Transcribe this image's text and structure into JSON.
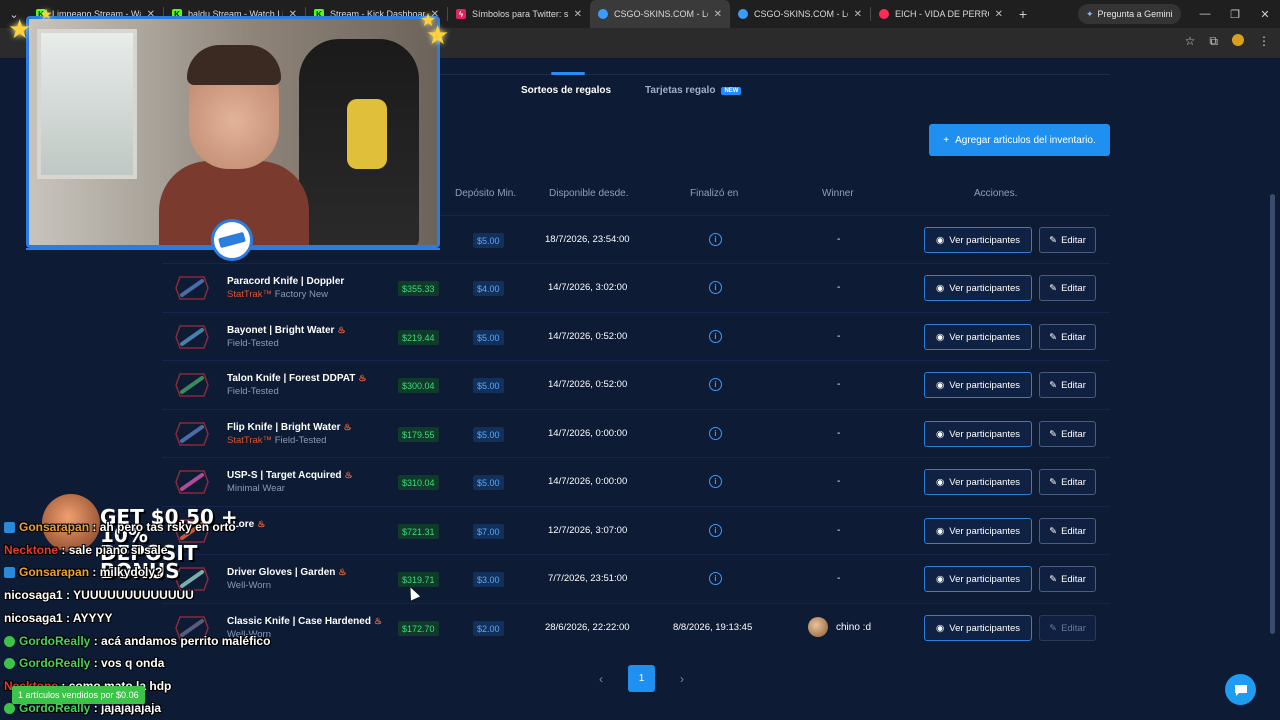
{
  "browser": {
    "tabs": [
      {
        "title": "Limpeano Stream - Watch",
        "color": "#53fc18",
        "letter": "K"
      },
      {
        "title": "baldu Stream - Watch Live",
        "color": "#53fc18",
        "letter": "K"
      },
      {
        "title": "Stream - Kick Dashboard",
        "color": "#53fc18",
        "letter": "K"
      },
      {
        "title": "Símbolos para Twitter: sig",
        "color": "#e0245e",
        "letter": "S"
      },
      {
        "title": "CSGO-SKINS.COM - Lo",
        "color": "#3a9cff",
        "letter": "C",
        "active": true
      },
      {
        "title": "CSGO-SKINS.COM - Los m",
        "color": "#3a9cff",
        "letter": "C"
      },
      {
        "title": "EICH - VIDA DE PERRO",
        "color": "#ff2d55",
        "letter": "E"
      }
    ],
    "gemini_label": "Pregunta a Gemini"
  },
  "page": {
    "tab_giveaways": "Sorteos de regalos",
    "tab_giftcards": "Tarjetas regalo",
    "badge_new": "NEW",
    "add_button": "Agregar articulos del inventario.",
    "columns": {
      "deposit": "Depósito Min.",
      "available": "Disponible desde.",
      "ended": "Finalizó en",
      "winner": "Winner",
      "actions": "Acciones."
    },
    "btn_participants": "Ver participantes",
    "btn_edit": "Editar",
    "rows": [
      {
        "name": "",
        "wear": "",
        "stattrak": "",
        "price": "",
        "deposit": "$5.00",
        "date": "18/7/2026, 23:54:00",
        "ended": "",
        "winner": "-"
      },
      {
        "name": "Paracord Knife | Doppler",
        "stattrak": "StatTrak™",
        "wear": "Factory New",
        "price": "$355.33",
        "deposit": "$4.00",
        "date": "14/7/2026, 3:02:00",
        "ended": "",
        "winner": "-"
      },
      {
        "name": "Bayonet | Bright Water",
        "stattrak": "",
        "wear": "Field-Tested",
        "price": "$219.44",
        "deposit": "$5.00",
        "date": "14/7/2026, 0:52:00",
        "ended": "",
        "winner": "-"
      },
      {
        "name": "Talon Knife | Forest DDPAT",
        "stattrak": "",
        "wear": "Field-Tested",
        "price": "$300.04",
        "deposit": "$5.00",
        "date": "14/7/2026, 0:52:00",
        "ended": "",
        "winner": "-"
      },
      {
        "name": "Flip Knife | Bright Water",
        "stattrak": "StatTrak™",
        "wear": "Field-Tested",
        "price": "$179.55",
        "deposit": "$5.00",
        "date": "14/7/2026, 0:00:00",
        "ended": "",
        "winner": "-"
      },
      {
        "name": "USP-S | Target Acquired",
        "stattrak": "",
        "wear": "Minimal Wear",
        "price": "$310.04",
        "deposit": "$5.00",
        "date": "14/7/2026, 0:00:00",
        "ended": "",
        "winner": "-"
      },
      {
        "name": "| Lore",
        "stattrak": "",
        "wear": "",
        "price": "$721.31",
        "deposit": "$7.00",
        "date": "12/7/2026, 3:07:00",
        "ended": "",
        "winner": "-"
      },
      {
        "name": "Driver Gloves | Garden",
        "stattrak": "",
        "wear": "Well-Worn",
        "price": "$319.71",
        "deposit": "$3.00",
        "date": "7/7/2026, 23:51:00",
        "ended": "",
        "winner": "-"
      },
      {
        "name": "Classic Knife | Case Hardened",
        "stattrak": "",
        "wear": "Well-Worn",
        "price": "$172.70",
        "deposit": "$2.00",
        "date": "28/6/2026, 22:22:00",
        "ended": "8/8/2026, 19:13:45",
        "winner": "chino :d",
        "edit_disabled": true
      }
    ],
    "pagination": {
      "current": "1"
    }
  },
  "overlay": {
    "bonus_line1": "GET $0.50 + 10%",
    "bonus_line2": "DEPOSIT BONUS",
    "sold_banner": "1 artículos vendidos por $0.06",
    "chat": [
      {
        "user": "Gonsarapan",
        "msg": ": ah pero tas rsky en orto",
        "color": "orange",
        "badge": "kick"
      },
      {
        "user": "Necktone",
        "msg": ": sale piano si sale",
        "color": "red",
        "badge": ""
      },
      {
        "user": "Gonsarapan",
        "msg": ": milkydoly?",
        "color": "orange",
        "badge": "kick"
      },
      {
        "user": "nicosaga1",
        "msg": ": YUUUUUUUUUUUUU",
        "color": "white",
        "badge": ""
      },
      {
        "user": "nicosaga1",
        "msg": ": AYYYY",
        "color": "white",
        "badge": ""
      },
      {
        "user": "GordoReally",
        "msg": ": acá andamos perrito maléfico",
        "color": "green",
        "badge": "green"
      },
      {
        "user": "GordoReally",
        "msg": ": vos q onda",
        "color": "green",
        "badge": "green"
      },
      {
        "user": "Necktone",
        "msg": ": como mato la hdp",
        "color": "red",
        "badge": ""
      },
      {
        "user": "GordoReally",
        "msg": ": jajajajajaja",
        "color": "green",
        "badge": "green"
      }
    ]
  }
}
